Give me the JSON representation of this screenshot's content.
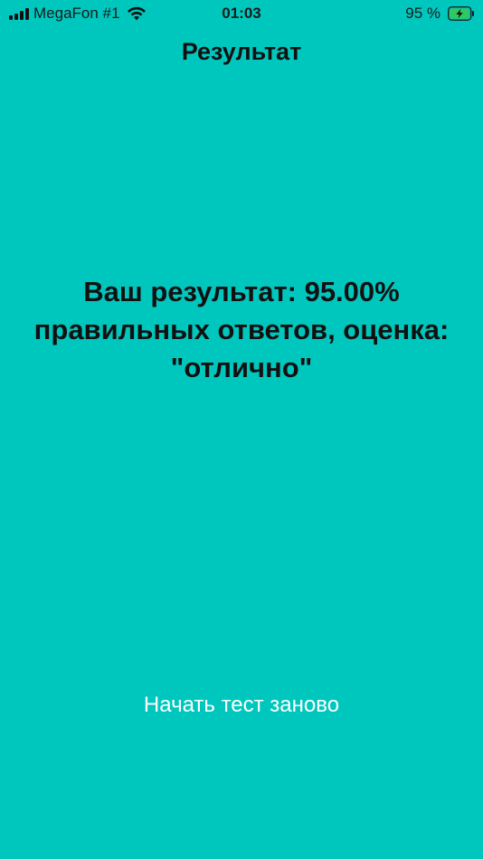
{
  "status_bar": {
    "carrier": "MegaFon #1",
    "time": "01:03",
    "battery_percent": "95 %",
    "signal_icon": "cellular-signal-icon",
    "wifi_icon": "wifi-icon",
    "battery_icon": "battery-charging-icon",
    "battery_level": 0.95,
    "battery_color": "#34C759"
  },
  "nav": {
    "title": "Результат"
  },
  "result": {
    "text": "Ваш результат: 95.00% правильных ответов, оценка: \"отлично\""
  },
  "actions": {
    "restart_label": "Начать тест заново"
  },
  "colors": {
    "background": "#00C7BE",
    "button_text": "#FFFFFF"
  }
}
